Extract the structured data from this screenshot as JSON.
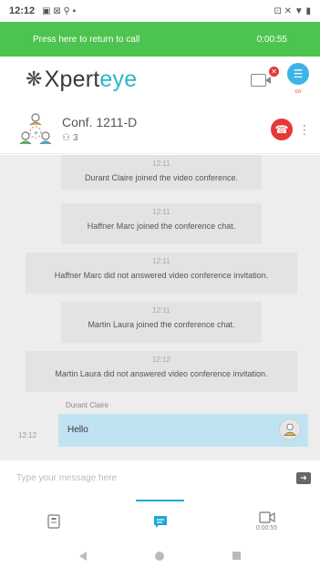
{
  "status_bar": {
    "time": "12:12",
    "left_icons": "▣ ⊠ ⚲ ▪",
    "right_icons": "⊡ ✕ ▼ ▮"
  },
  "call_banner": {
    "label": "Press here to return to call",
    "timer": "0:00:55"
  },
  "brand": {
    "logo_prefix": "Xpert",
    "logo_suffix": "eye"
  },
  "conference": {
    "title": "Conf. 1211-D",
    "participants": "3"
  },
  "messages": [
    {
      "time": "12:11",
      "text": "Durant Claire joined the video conference."
    },
    {
      "time": "12:11",
      "text": "Haffner Marc joined the conference chat."
    },
    {
      "time": "12:11",
      "text": "Haffner Marc did not answered video conference invitation."
    },
    {
      "time": "12:11",
      "text": "Martin Laura joined the conference chat."
    },
    {
      "time": "12:12",
      "text": "Martin Laura did not answered video conference invitation."
    }
  ],
  "user_message": {
    "sender": "Durant Claire",
    "time": "12:12",
    "text": "Hello"
  },
  "composer": {
    "placeholder": "Type your message here",
    "value": ""
  },
  "tabs": {
    "video_timer": "0:00:55"
  },
  "colors": {
    "banner": "#4cc44f",
    "accent": "#2bb8c8",
    "menu": "#3db4e6",
    "hangup": "#e53935",
    "bubble": "#bfe3f1"
  }
}
